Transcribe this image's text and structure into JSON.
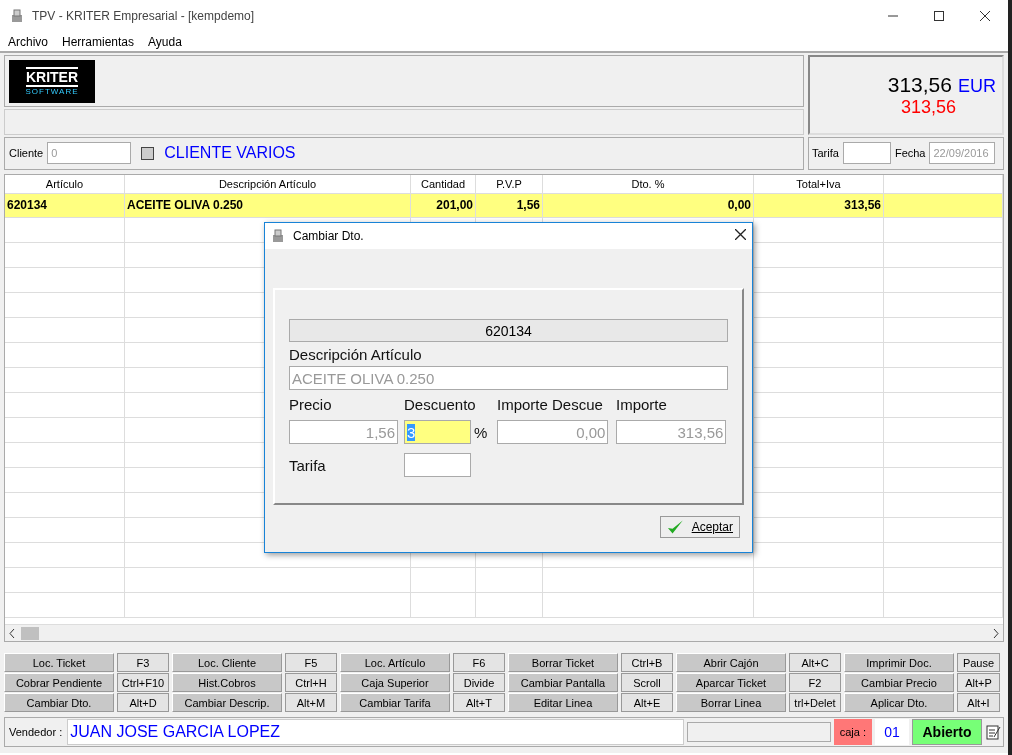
{
  "window": {
    "title": "TPV - KRITER Empresarial -  [kempdemo]"
  },
  "menu": [
    "Archivo",
    "Herramientas",
    "Ayuda"
  ],
  "logo": {
    "line1": "KRITER",
    "line2": "SOFTWARE"
  },
  "totals": {
    "amount": "313,56",
    "currency": "EUR",
    "secondary": "313,56"
  },
  "customer": {
    "label": "Cliente",
    "value": "0",
    "checked": false,
    "name": "CLIENTE VARIOS",
    "tariff_label": "Tarifa",
    "date_label": "Fecha",
    "date_value": "22/09/2016"
  },
  "table": {
    "columns": [
      "Artículo",
      "Descripción Artículo",
      "Cantidad",
      "P.V.P",
      "Dto. %",
      "Total+Iva"
    ],
    "rows": [
      {
        "cells": [
          "620134",
          "ACEITE OLIVA 0.250",
          "201,00",
          "1,56",
          "0,00",
          "313,56"
        ],
        "selected": true
      }
    ]
  },
  "function_keys": [
    [
      {
        "label": "Loc. Ticket",
        "key": "F3"
      },
      {
        "label": "Loc. Cliente",
        "key": "F5"
      },
      {
        "label": "Loc. Artículo",
        "key": "F6"
      },
      {
        "label": "Borrar Ticket",
        "key": "Ctrl+B"
      },
      {
        "label": "Abrir Cajón",
        "key": "Alt+C"
      },
      {
        "label": "Imprimir Doc.",
        "key": "Pause"
      }
    ],
    [
      {
        "label": "Cobrar Pendiente",
        "key": "Ctrl+F10"
      },
      {
        "label": "Hist.Cobros",
        "key": "Ctrl+H"
      },
      {
        "label": "Caja Superior",
        "key": "Divide"
      },
      {
        "label": "Cambiar Pantalla",
        "key": "Scroll"
      },
      {
        "label": "Aparcar Ticket",
        "key": "F2"
      },
      {
        "label": "Cambiar Precio",
        "key": "Alt+P"
      }
    ],
    [
      {
        "label": "Cambiar Dto.",
        "key": "Alt+D"
      },
      {
        "label": "Cambiar Descrip.",
        "key": "Alt+M"
      },
      {
        "label": "Cambiar Tarifa",
        "key": "Alt+T"
      },
      {
        "label": "Editar Linea",
        "key": "Alt+E"
      },
      {
        "label": "Borrar Linea",
        "key": "trl+Delet"
      },
      {
        "label": "Aplicar Dto.",
        "key": "Alt+I"
      }
    ]
  ],
  "status_bar": {
    "seller_label": "Vendedor :",
    "seller": "JUAN JOSE GARCIA LOPEZ",
    "till_label": "caja :",
    "till": "01",
    "state": "Abierto"
  },
  "dialog": {
    "title": "Cambiar Dto.",
    "code": "620134",
    "description_label": "Descripción Artículo",
    "description": "ACEITE OLIVA 0.250",
    "price_label": "Precio",
    "discount_label": "Descuento",
    "discount_amount_label": "Importe Descue",
    "amount_label": "Importe",
    "price": "1,56",
    "discount": "3",
    "percent": "%",
    "discount_amount": "0,00",
    "amount": "313,56",
    "tariff_label": "Tarifa",
    "ok": "Aceptar"
  }
}
